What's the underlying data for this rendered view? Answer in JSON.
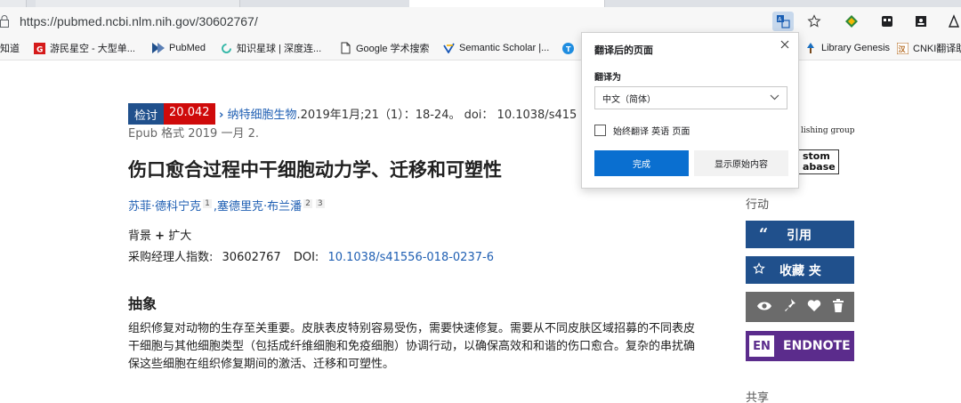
{
  "browser": {
    "url": "https://pubmed.ncbi.nlm.nih.gov/30602767/",
    "icons": [
      "lock-icon",
      "translate-icon",
      "star-icon",
      "extension-icon",
      "collections-icon",
      "profile-icon",
      "reading-icon"
    ]
  },
  "bookmarks": [
    {
      "label": "知道",
      "icon": ""
    },
    {
      "label": "游民星空 - 大型单...",
      "icon": "G"
    },
    {
      "label": "PubMed",
      "icon": "pubmed"
    },
    {
      "label": "知识星球 | 深度连...",
      "icon": "circle"
    },
    {
      "label": "Google 学术搜索",
      "icon": "page"
    },
    {
      "label": "Semantic Scholar |...",
      "icon": "ss"
    },
    {
      "label": "Library Genesis",
      "icon": "lg"
    },
    {
      "label": "CNKI翻译助",
      "icon": "cnki"
    }
  ],
  "article": {
    "badge_left": "检讨",
    "badge_right": "20.042",
    "journal": "纳特细胞生物",
    "citation_rest": ".2019年1月;21（1）：18-24。 doi： 10.1038/s415",
    "epub": "Epub 格式 2019 一月 2.",
    "title": "伤口愈合过程中干细胞动力学、迁移和可塑性",
    "author1": "苏菲·德科宁克",
    "author1_sup": "1",
    "author2": "塞德里克·布兰潘",
    "author2_sups": [
      "2",
      "3"
    ],
    "expand_label": "背景",
    "expand_plus": "+",
    "expand_text": "扩大",
    "pmid_label": "采购经理人指数:",
    "pmid": "30602767",
    "doi_label": "DOI:",
    "doi": "10.1038/s41556-018-0237-6",
    "abstract_heading": "抽象",
    "abstract": "组织修复对动物的生存至关重要。皮肤表皮特别容易受伤，需要快速修复。需要从不同皮肤区域招募的不同表皮干细胞与其他细胞类型（包括成纤维细胞和免疫细胞）协调行动，以确保高效和和谐的伤口愈合。复杂的串扰确保这些细胞在组织修复期间的激活、迁移和可塑性。"
  },
  "sidebar": {
    "publisher_logo_text": "lishing group",
    "custom_db_text": "stom abase",
    "actions_heading": "行动",
    "cite_label": "引用",
    "favorites_label": "收藏 夹",
    "endnote_box": "EN",
    "endnote_label": "ENDNOTE",
    "share_heading": "共享",
    "tool_icons": [
      "eye-icon",
      "pin-icon",
      "heart-icon",
      "trash-icon"
    ]
  },
  "translate_popup": {
    "title": "翻译后的页面",
    "translate_to_label": "翻译为",
    "language": "中文（简体）",
    "always_translate": "始终翻译 英语 页面",
    "done": "完成",
    "show_original": "显示原始内容"
  },
  "colors": {
    "pubmed_blue": "#20508c",
    "badge_red": "#cf0a0a",
    "link_blue": "#1f5fb3",
    "endnote_purple": "#5b2c8c",
    "button_blue": "#0a6fd0"
  }
}
